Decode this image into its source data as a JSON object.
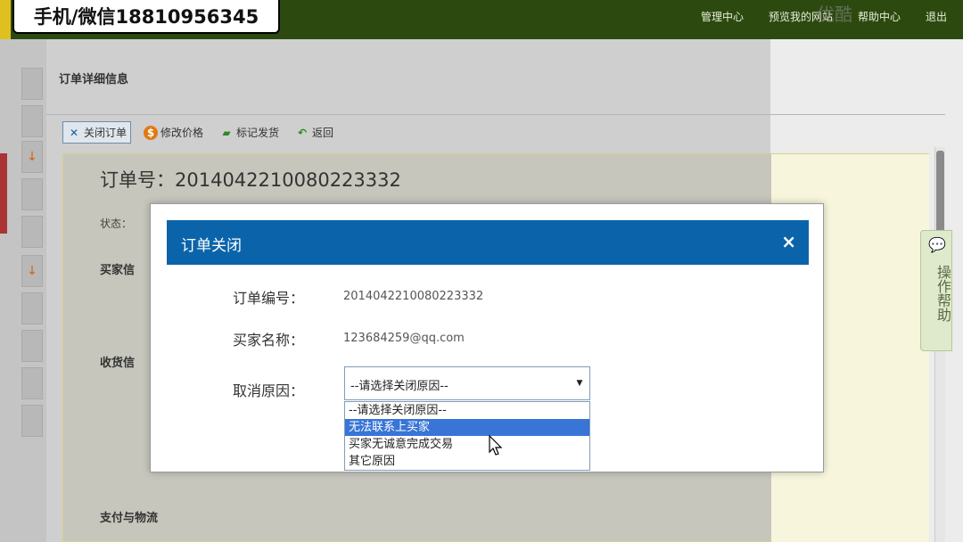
{
  "banner": {
    "text": "手机/微信18810956345"
  },
  "header": {
    "nav": [
      "管理中心",
      "预览我的网站",
      "帮助中心",
      "退出"
    ]
  },
  "watermark": "优酷",
  "page": {
    "title": "订单详细信息",
    "toolbar": [
      {
        "label": "关闭订单",
        "icon": "close-x-icon",
        "color": "#1a5aa8"
      },
      {
        "label": "修改价格",
        "icon": "price-icon",
        "color": "#e07a10"
      },
      {
        "label": "标记发货",
        "icon": "truck-icon",
        "color": "#2a8a2a"
      },
      {
        "label": "返回",
        "icon": "back-arrow-icon",
        "color": "#2a8a2a"
      }
    ],
    "order_no": "订单号：2014042210080223332",
    "status_label": "状态：",
    "sections": {
      "buyer": "买家信",
      "receive": "收货信",
      "pay": "支付与物流"
    }
  },
  "help_tab": {
    "label": "操作帮助"
  },
  "modal": {
    "title": "订单关闭",
    "close_glyph": "×",
    "fields": [
      {
        "label": "订单编号：",
        "value": "2014042210080223332"
      },
      {
        "label": "买家名称：",
        "value": "123684259@qq.com"
      },
      {
        "label": "取消原因：",
        "value": ""
      }
    ],
    "select": {
      "selected": "--请选择关闭原因--",
      "options": [
        "--请选择关闭原因--",
        "无法联系上买家",
        "买家无诚意完成交易",
        "其它原因"
      ],
      "highlighted_index": 1
    }
  },
  "colors": {
    "modal_header": "#0b64aa",
    "topbar": "#2c4a10",
    "option_highlight": "#3875d7"
  }
}
